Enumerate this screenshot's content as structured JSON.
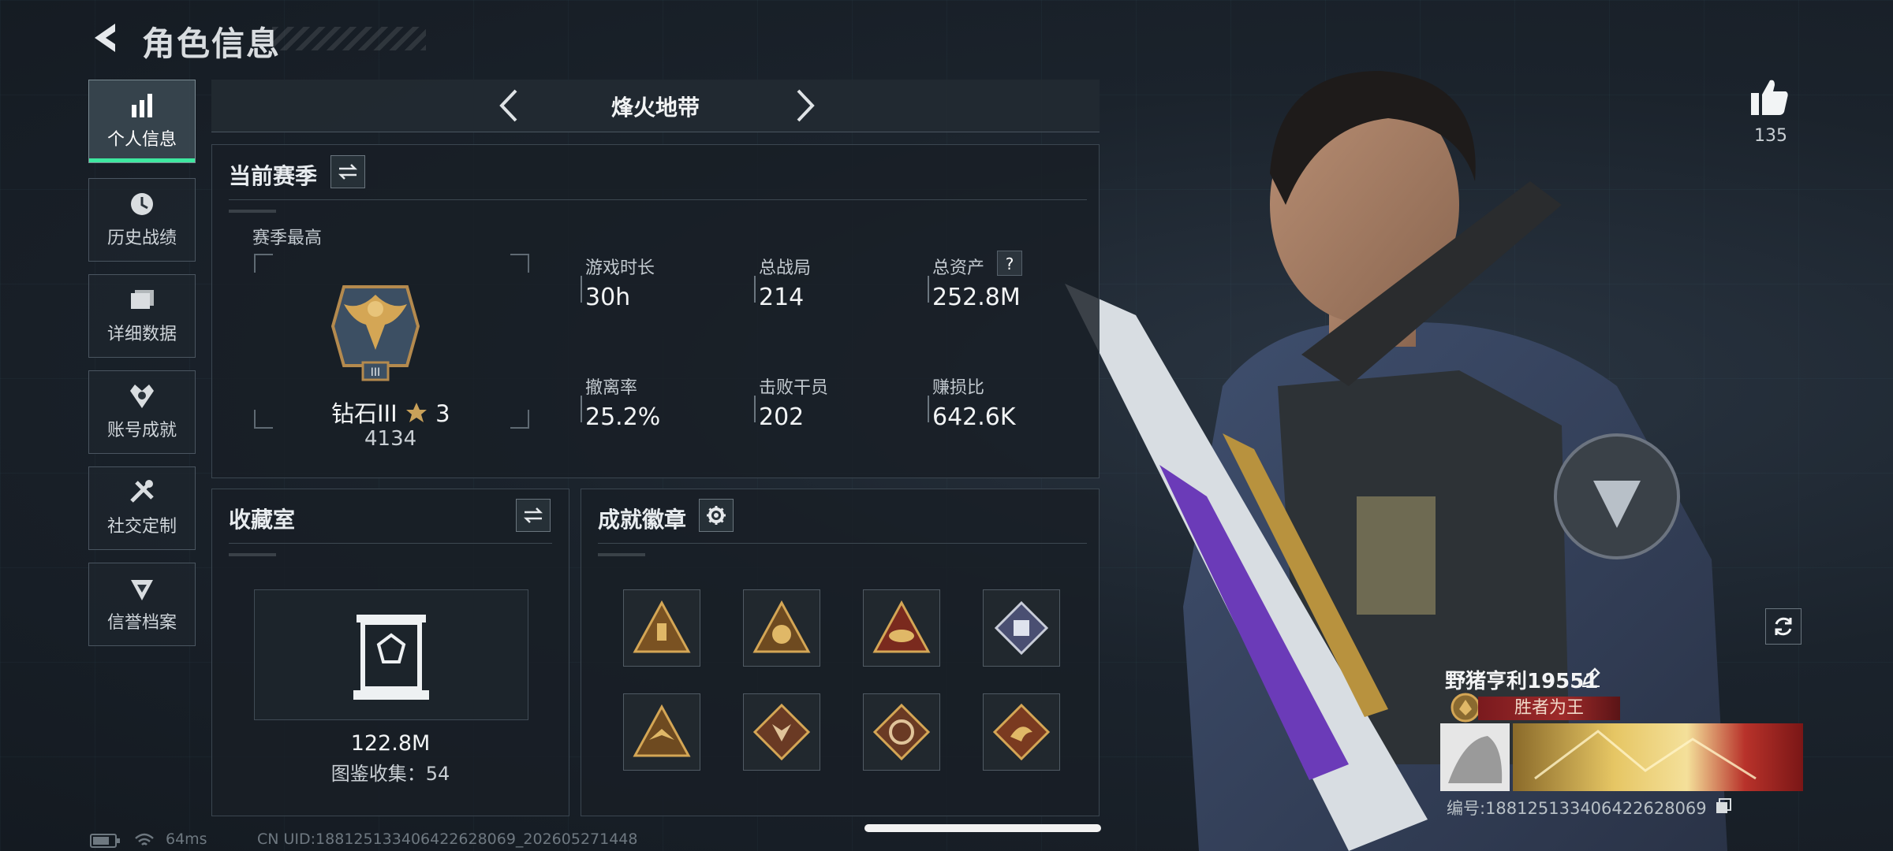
{
  "header": {
    "title": "角色信息"
  },
  "sidebar": {
    "items": [
      {
        "label": "个人信息",
        "icon": "bar-chart-icon",
        "active": true
      },
      {
        "label": "历史战绩",
        "icon": "clock-history-icon",
        "active": false
      },
      {
        "label": "详细数据",
        "icon": "folder-icon",
        "active": false
      },
      {
        "label": "账号成就",
        "icon": "medal-icon",
        "active": false
      },
      {
        "label": "社交定制",
        "icon": "tools-icon",
        "active": false
      },
      {
        "label": "信誉档案",
        "icon": "shield-icon",
        "active": false
      }
    ]
  },
  "mode": {
    "title": "烽火地带"
  },
  "season": {
    "section_title": "当前赛季",
    "best_label": "赛季最高",
    "rank_name": "钻石III",
    "rank_stars": "3",
    "rank_score": "4134",
    "rank_emblem_numeral": "III",
    "stats": [
      {
        "label": "游戏时长",
        "value": "30h"
      },
      {
        "label": "总战局",
        "value": "214"
      },
      {
        "label": "总资产",
        "value": "252.8M",
        "help": "?"
      },
      {
        "label": "撤离率",
        "value": "25.2%"
      },
      {
        "label": "击败干员",
        "value": "202"
      },
      {
        "label": "赚损比",
        "value": "642.6K"
      }
    ]
  },
  "collection": {
    "section_title": "收藏室",
    "value": "122.8M",
    "catalog": "图鉴收集：54"
  },
  "achievements": {
    "section_title": "成就徽章",
    "badges": [
      "flask-badge-icon",
      "gear-crown-badge-icon",
      "hat-badge-icon",
      "fist-badge-icon",
      "eagle-badge-icon",
      "wolf-badge-icon",
      "wheel-badge-icon",
      "dragon-badge-icon"
    ]
  },
  "status_bar": {
    "ping": "64ms",
    "uid": "CN UID:18812513340642262806​9_202605271448"
  },
  "profile": {
    "likes": "135",
    "player_name": "野猪亨利19551",
    "title_badge": "胜者为王",
    "id_line": "编号:188125133406422628069"
  },
  "colors": {
    "accent": "#3ee8a0",
    "title_red": "#9e2a2a",
    "gold": "#c9a15a"
  }
}
